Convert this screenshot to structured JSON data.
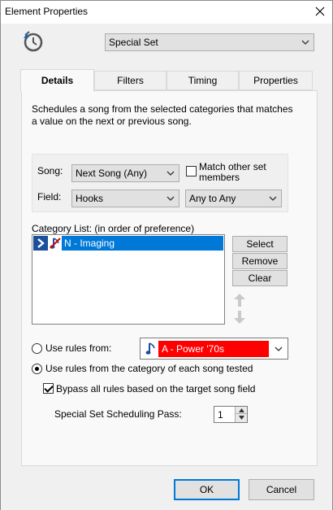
{
  "window": {
    "title": "Element Properties"
  },
  "header": {
    "element_type": "Special Set"
  },
  "tabs": [
    {
      "label": "Details"
    },
    {
      "label": "Filters"
    },
    {
      "label": "Timing"
    },
    {
      "label": "Properties"
    }
  ],
  "details": {
    "description": "Schedules a song from the selected categories that matches a value on the next or previous song.",
    "song_label": "Song:",
    "song_value": "Next Song (Any)",
    "match_label": "Match other set members",
    "match_checked": false,
    "field_label": "Field:",
    "field_value": "Hooks",
    "range_value": "Any to Any",
    "category_list_label": "Category List: (in order of preference)",
    "category_items": [
      {
        "label": "N - Imaging"
      }
    ],
    "select_button": "Select",
    "remove_button": "Remove",
    "clear_button": "Clear",
    "use_rules_from_label": "Use rules from:",
    "use_rules_from_value": "A - Power '70s",
    "use_rules_category_label": "Use rules from the category of each song tested",
    "bypass_label": "Bypass all rules based on the target song field",
    "bypass_checked": true,
    "pass_label": "Special Set Scheduling Pass:",
    "pass_value": "1"
  },
  "footer": {
    "ok": "OK",
    "cancel": "Cancel"
  },
  "colors": {
    "accent": "#0078d7",
    "rule_color": "#ff0000",
    "list_arrow": "#1a4f9c"
  }
}
